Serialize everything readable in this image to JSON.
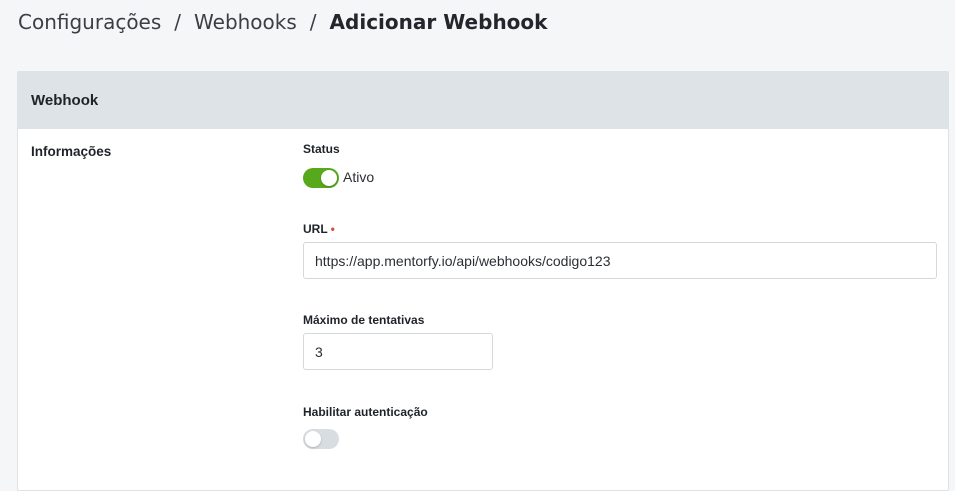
{
  "breadcrumb": {
    "items": [
      "Configurações",
      "Webhooks"
    ],
    "current": "Adicionar Webhook",
    "separator": "/"
  },
  "card": {
    "title": "Webhook",
    "section_label": "Informações"
  },
  "form": {
    "status": {
      "label": "Status",
      "enabled": true,
      "state_text": "Ativo"
    },
    "url": {
      "label": "URL",
      "required_marker": "•",
      "value": "https://app.mentorfy.io/api/webhooks/codigo123"
    },
    "max_attempts": {
      "label": "Máximo de tentativas",
      "value": "3"
    },
    "auth": {
      "label": "Habilitar autenticação",
      "enabled": false
    }
  },
  "colors": {
    "toggle_on": "#58a81c",
    "toggle_off": "#d8dde2",
    "header_bg": "#dde3e6",
    "required": "#e04848"
  }
}
